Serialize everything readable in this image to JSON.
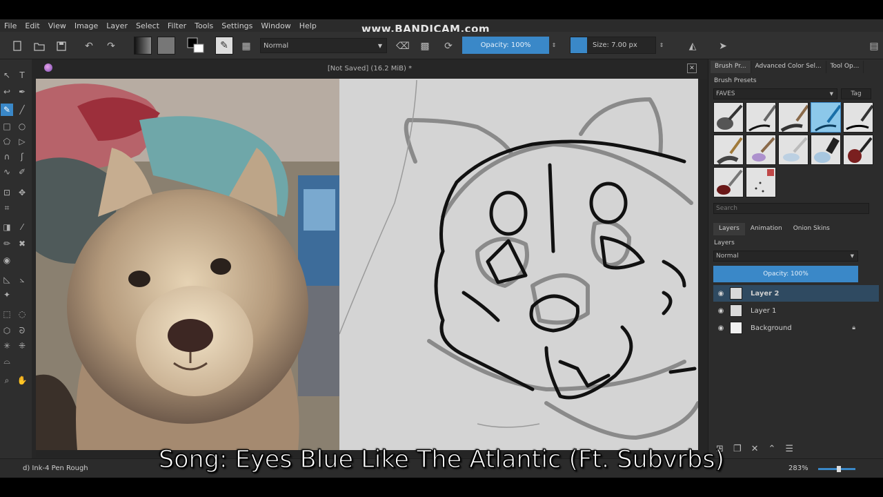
{
  "watermark": "www.BANDICAM.com",
  "menu": [
    "File",
    "Edit",
    "View",
    "Image",
    "Layer",
    "Select",
    "Filter",
    "Tools",
    "Settings",
    "Window",
    "Help"
  ],
  "toolbar": {
    "blend_mode": "Normal",
    "opacity_label": "Opacity: 100%",
    "size_label": "Size: 7.00 px",
    "accent_color": "#3a88c8"
  },
  "document": {
    "title": "[Not Saved]  (16.2 MiB) *"
  },
  "dock": {
    "tabs": [
      "Brush Pr...",
      "Advanced Color Sel...",
      "Tool Op..."
    ],
    "brush_presets_title": "Brush Presets",
    "tag_filter": "FAVES",
    "tag_button": "Tag",
    "search_placeholder": "Search"
  },
  "layers_panel": {
    "tabs": [
      "Layers",
      "Animation",
      "Onion Skins"
    ],
    "title": "Layers",
    "blend_mode": "Normal",
    "opacity_label": "Opacity:  100%",
    "layers": [
      {
        "name": "Layer 2",
        "selected": true
      },
      {
        "name": "Layer 1",
        "selected": false
      },
      {
        "name": "Background",
        "selected": false,
        "locked": true
      }
    ]
  },
  "status": {
    "brush_name": "d) Ink-4 Pen Rough",
    "zoom": "283%"
  },
  "caption": "Song: Eyes Blue Like The Atlantic (Ft. Subvrbs)"
}
